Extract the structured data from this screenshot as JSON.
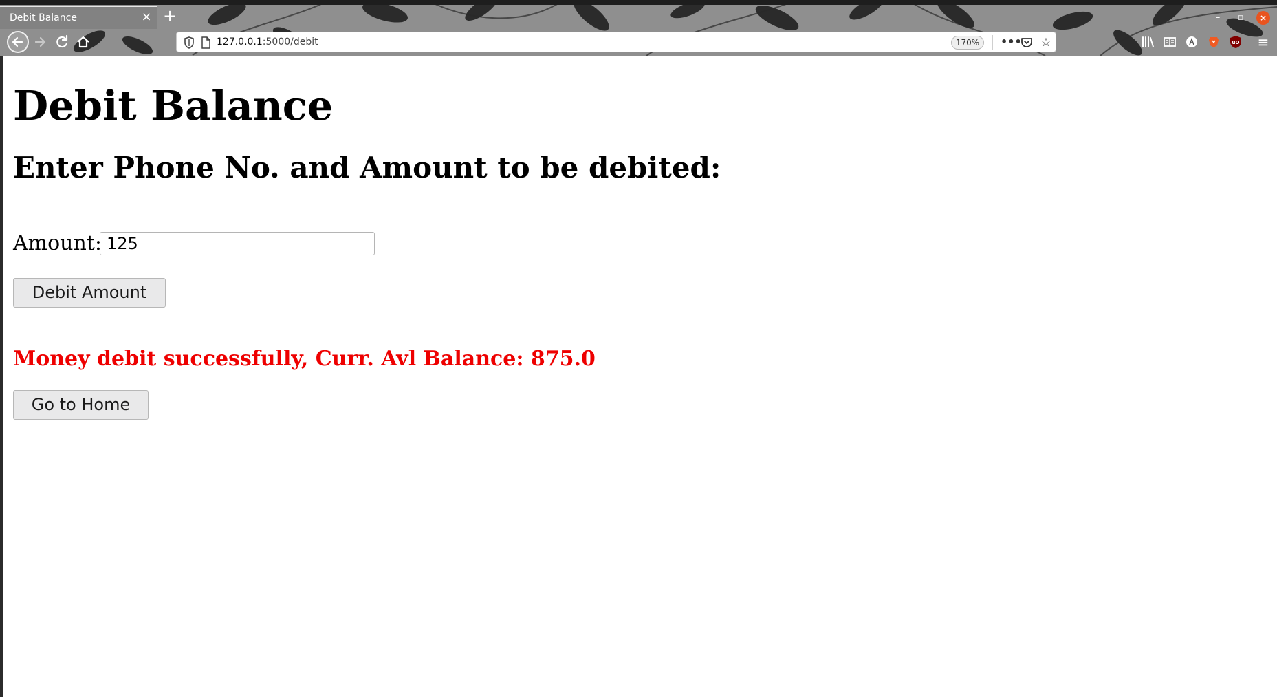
{
  "browser": {
    "tab_title": "Debit Balance",
    "url_host": "127.0.0.1",
    "url_path": ":5000/debit",
    "zoom": "170%",
    "close_glyph": "×",
    "new_tab_glyph": "+",
    "more_glyph": "•••",
    "window_controls": {
      "minimize": "–",
      "maximize": "▫",
      "close": "×"
    },
    "icons": [
      "back-arrow-icon",
      "forward-arrow-icon",
      "reload-icon",
      "home-icon",
      "shield-icon",
      "page-icon",
      "pocket-icon",
      "star-icon",
      "library-icon",
      "reader-icon",
      "account-icon",
      "brave-icon",
      "ublock-icon",
      "hamburger-menu-icon"
    ],
    "accent_close_color": "#e95420"
  },
  "page": {
    "title": "Debit Balance",
    "subtitle": "Enter Phone No. and Amount to be debited:",
    "amount_label": "Amount:",
    "amount_value": "125",
    "debit_button_label": "Debit Amount",
    "status_message": "Money debit successfully, Curr. Avl Balance: 875.0",
    "status_color": "#ee0000",
    "home_button_label": "Go to Home"
  }
}
